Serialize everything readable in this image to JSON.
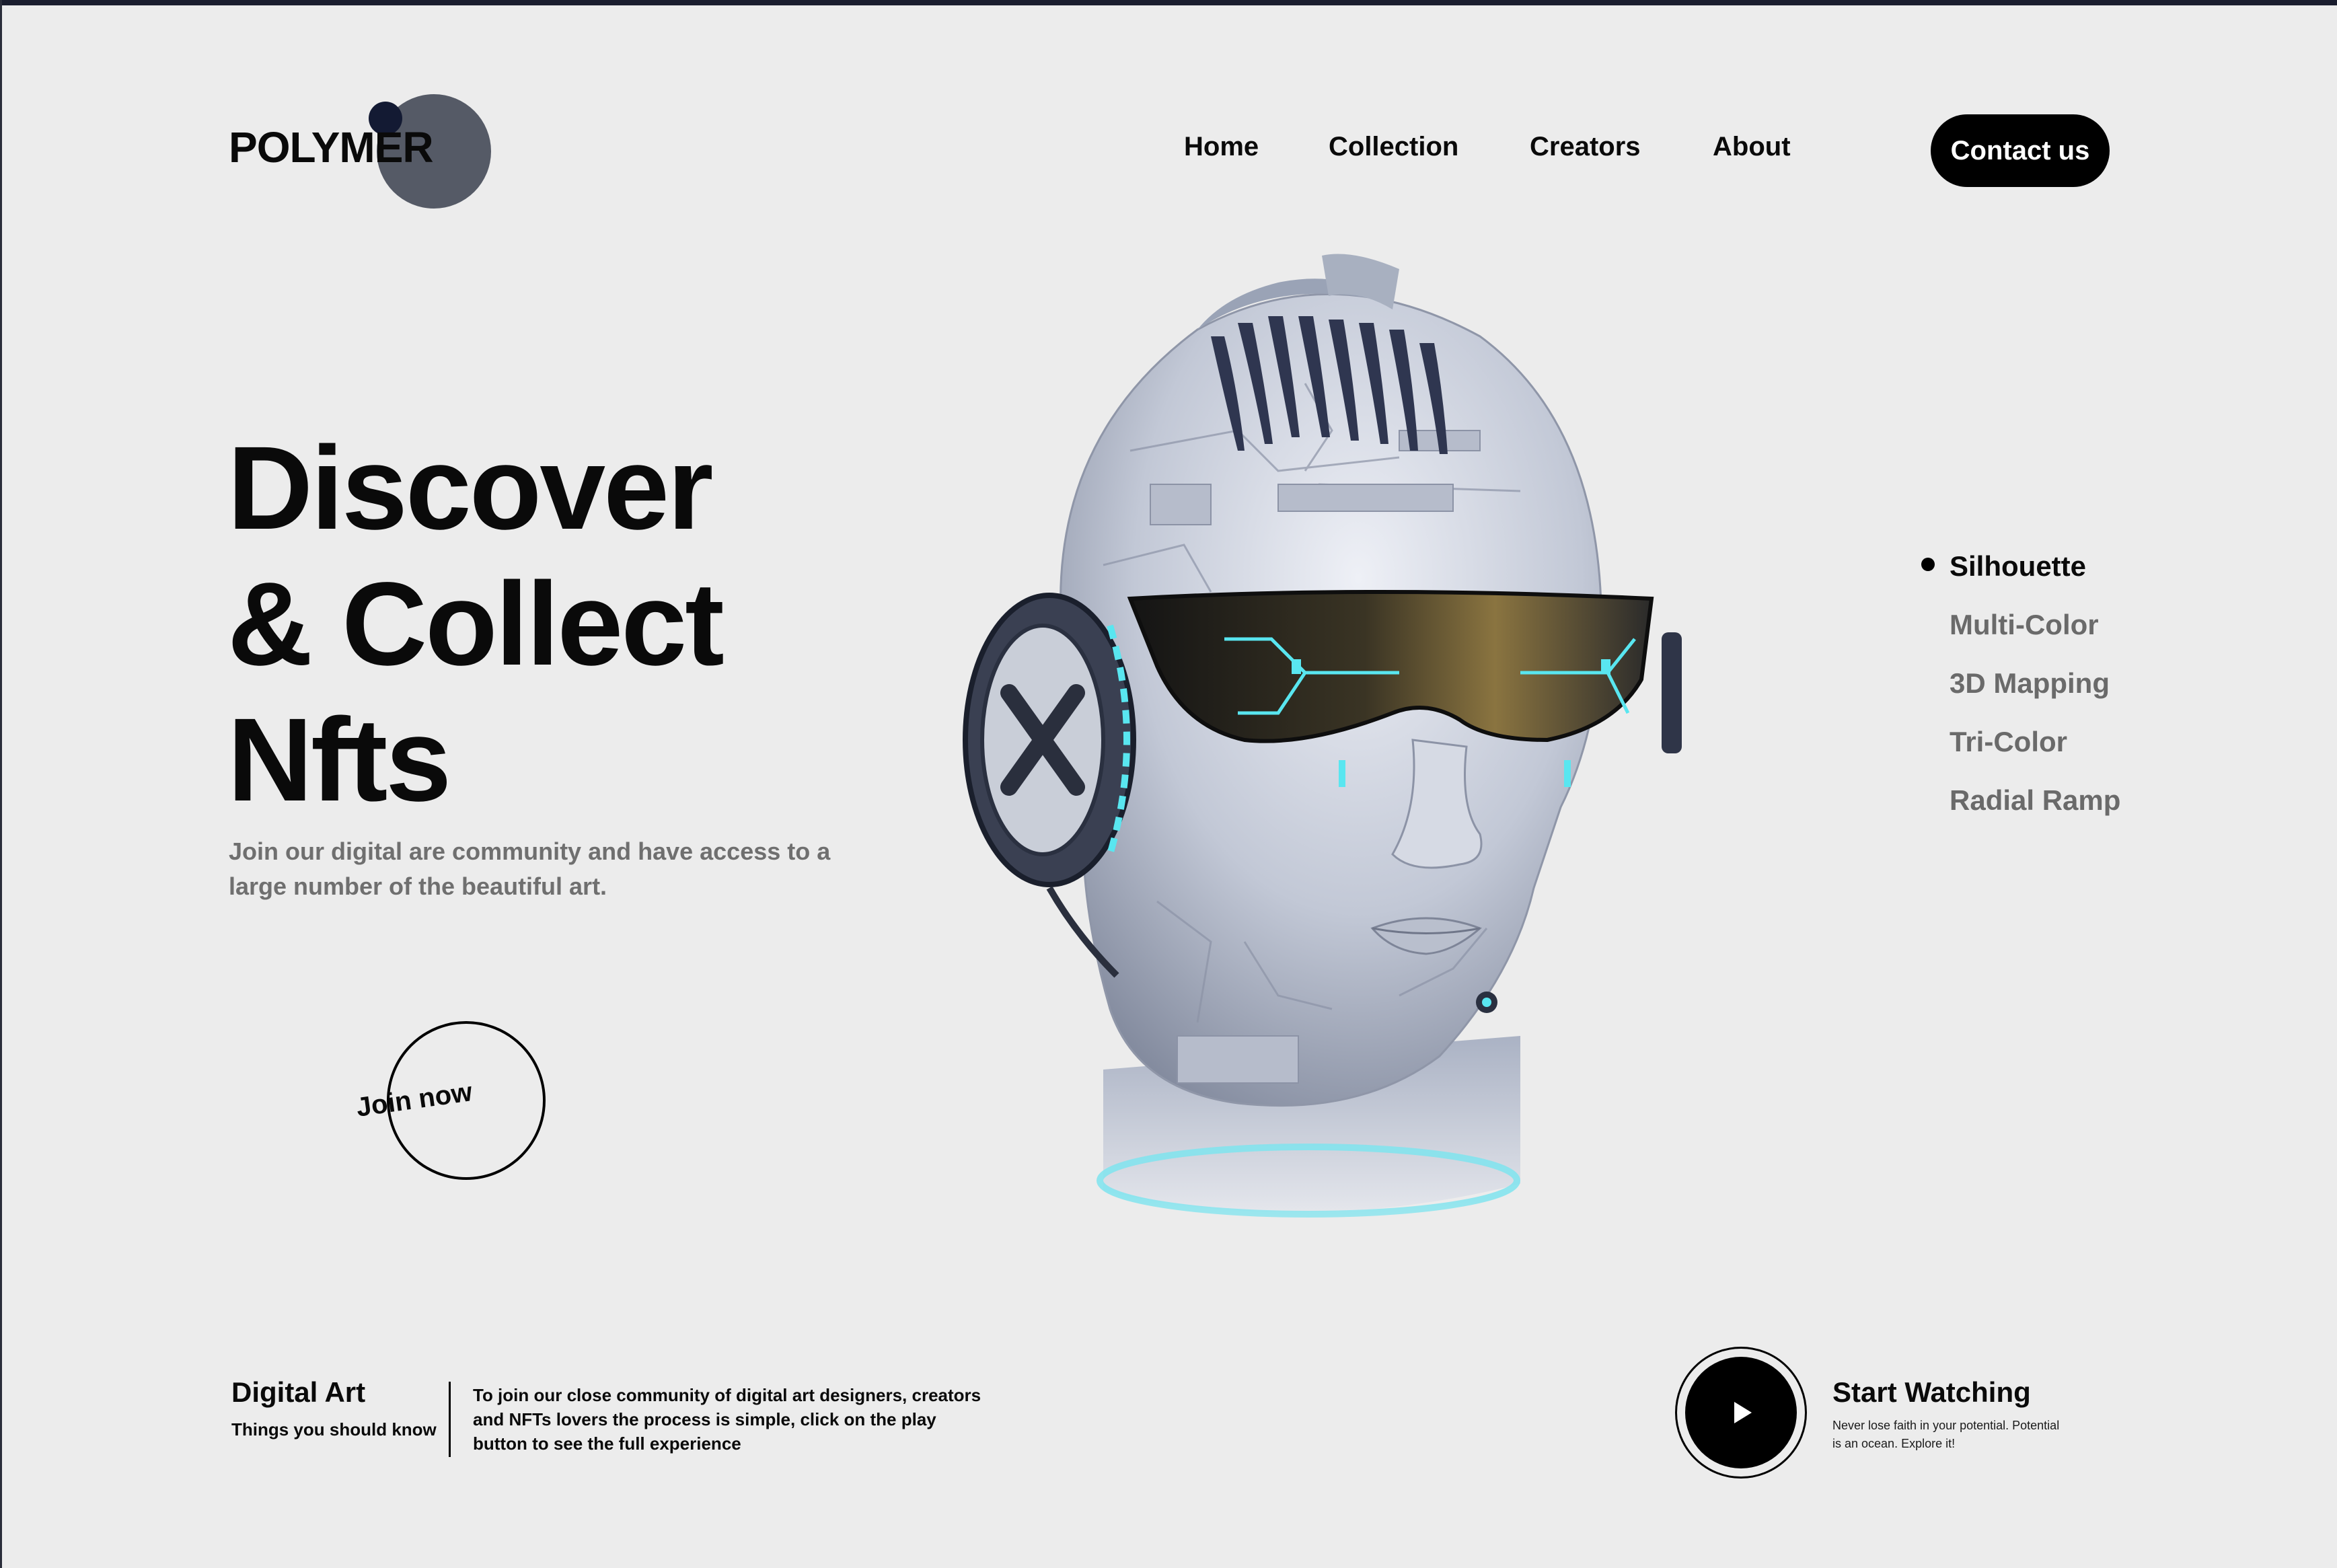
{
  "brand": {
    "name": "POLYMER"
  },
  "nav": {
    "items": [
      {
        "label": "Home"
      },
      {
        "label": "Collection"
      },
      {
        "label": "Creators"
      },
      {
        "label": "About"
      }
    ],
    "contact_label": "Contact us"
  },
  "hero": {
    "title_lines": [
      "Discover",
      "& Collect",
      "Nfts"
    ],
    "subtitle": "Join our digital are community and have access to a large number of the beautiful art.",
    "join_label": "Join now"
  },
  "variants": {
    "selected": "Silhouette",
    "items": [
      "Silhouette",
      "Multi-Color",
      "3D Mapping",
      "Tri-Color",
      "Radial Ramp"
    ]
  },
  "info": {
    "title": "Digital Art",
    "subtitle": "Things you should know",
    "text": "To join our close community of digital art designers, creators and NFTs lovers the process is simple, click on the play button to see the full experience"
  },
  "watch": {
    "title": "Start Watching",
    "subtitle": "Never lose faith in your potential. Potential is an ocean. Explore it!"
  },
  "colors": {
    "background": "#ececec",
    "text": "#0a0a0a",
    "muted": "#6a6a6a",
    "accent_glow": "#59e6f0"
  },
  "icons": [
    "play-icon",
    "logo-blob-icon"
  ]
}
